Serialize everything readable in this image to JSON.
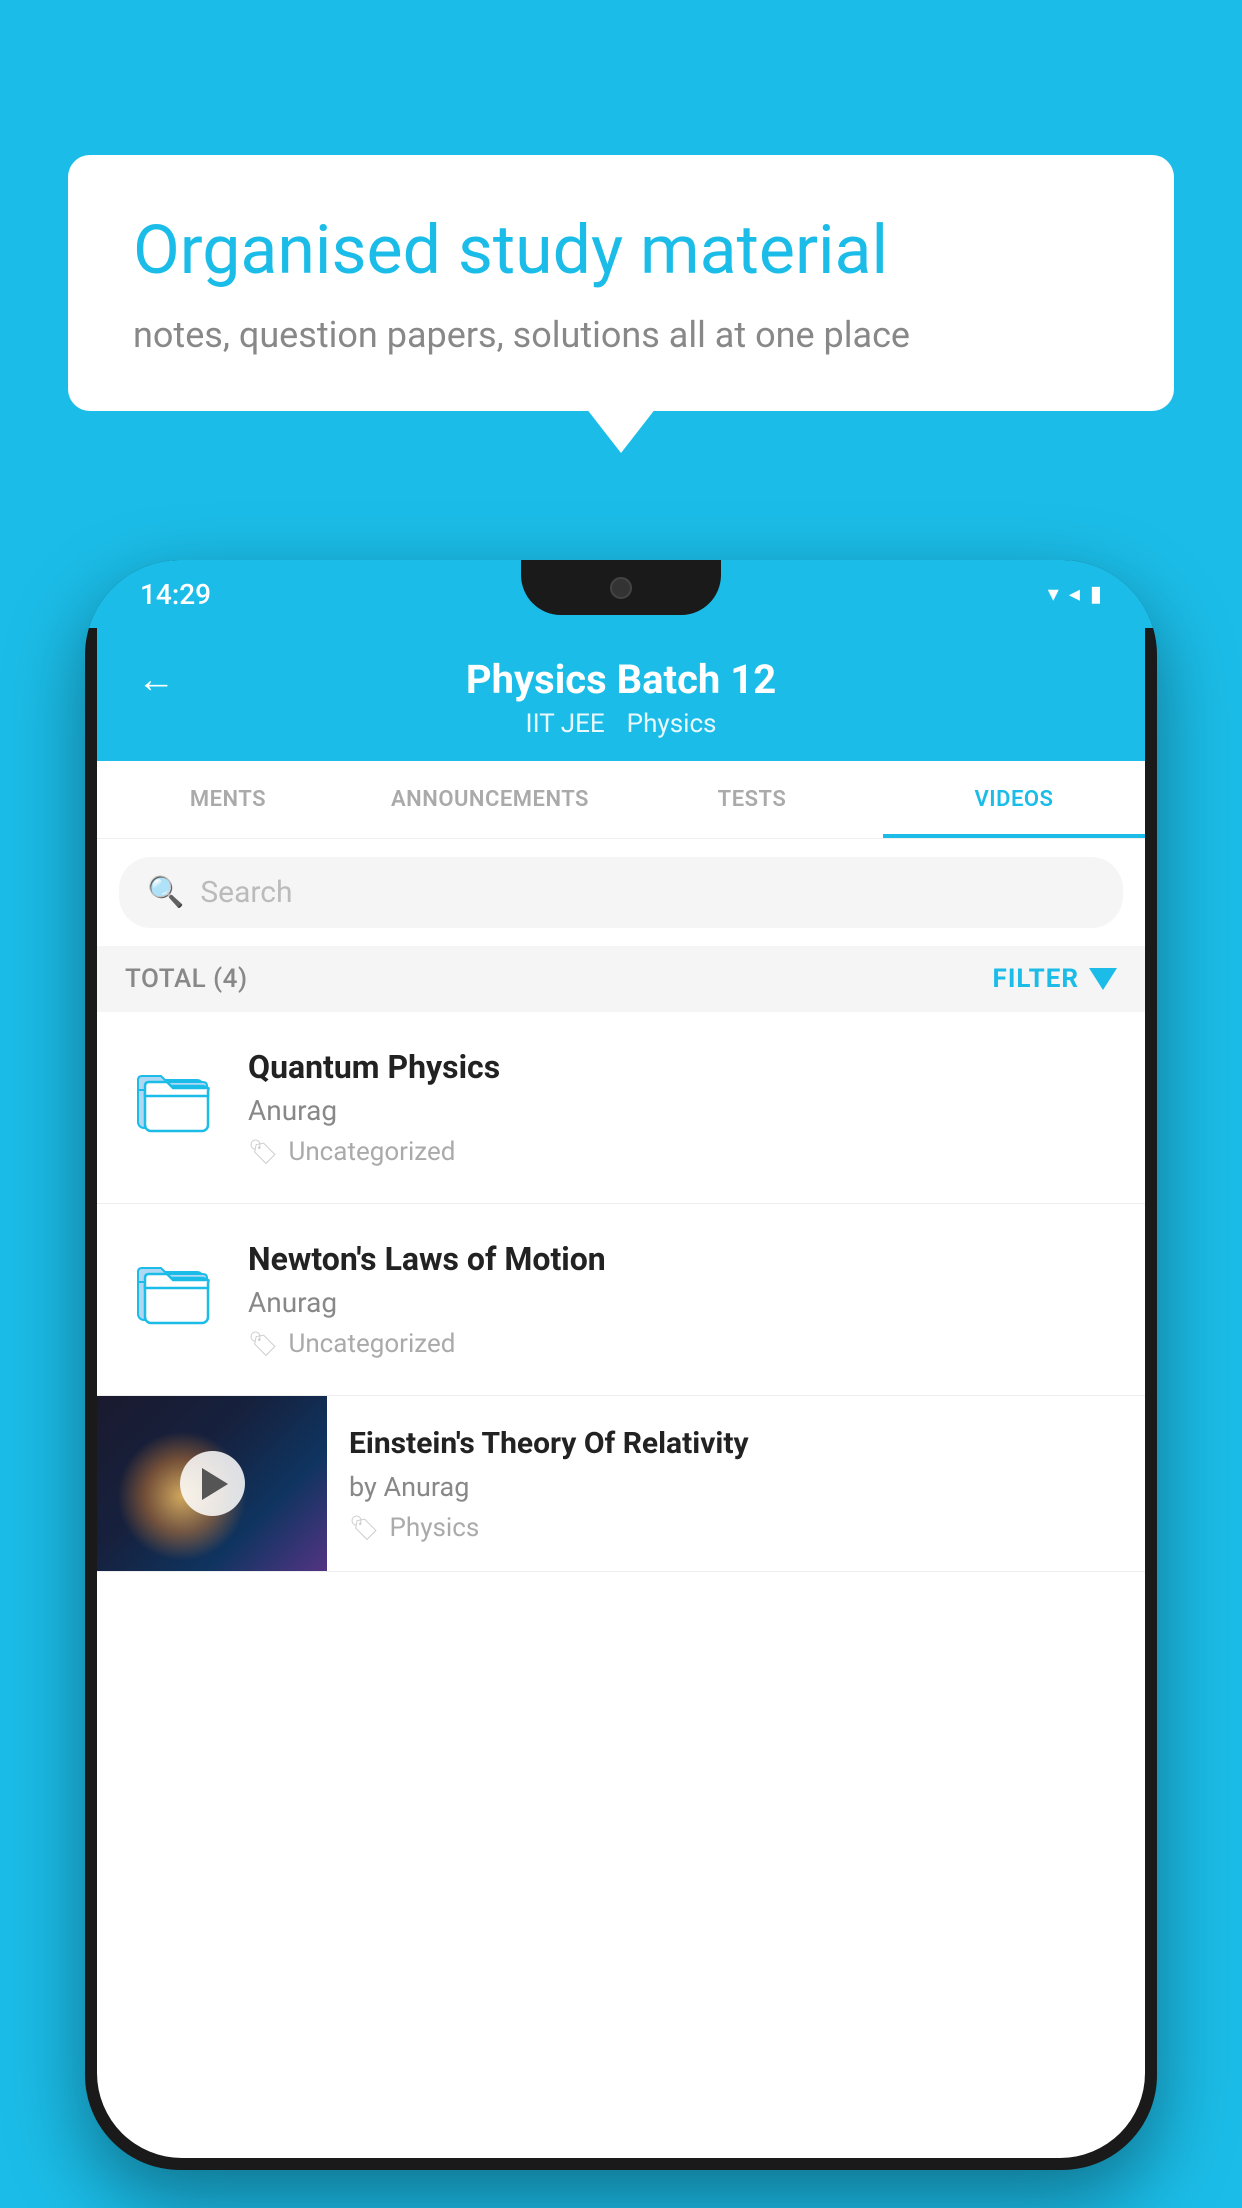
{
  "background_color": "#1BBDE8",
  "speech_bubble": {
    "title": "Organised study material",
    "subtitle": "notes, question papers, solutions all at one place"
  },
  "phone": {
    "status_bar": {
      "time": "14:29",
      "icons": [
        "wifi",
        "signal",
        "battery"
      ]
    },
    "app_bar": {
      "back_label": "←",
      "title": "Physics Batch 12",
      "subtitle_left": "IIT JEE",
      "subtitle_right": "Physics"
    },
    "tabs": [
      {
        "label": "MENTS",
        "active": false
      },
      {
        "label": "ANNOUNCEMENTS",
        "active": false
      },
      {
        "label": "TESTS",
        "active": false
      },
      {
        "label": "VIDEOS",
        "active": true
      }
    ],
    "search": {
      "placeholder": "Search"
    },
    "filter_row": {
      "total_label": "TOTAL (4)",
      "filter_label": "FILTER"
    },
    "videos": [
      {
        "id": 1,
        "title": "Quantum Physics",
        "author": "Anurag",
        "tag": "Uncategorized",
        "has_thumbnail": false
      },
      {
        "id": 2,
        "title": "Newton's Laws of Motion",
        "author": "Anurag",
        "tag": "Uncategorized",
        "has_thumbnail": false
      },
      {
        "id": 3,
        "title": "Einstein's Theory Of Relativity",
        "author": "by Anurag",
        "tag": "Physics",
        "has_thumbnail": true
      }
    ]
  }
}
